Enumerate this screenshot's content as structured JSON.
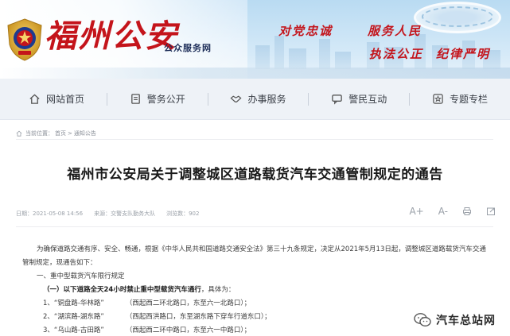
{
  "header": {
    "site_name": "福州公安",
    "site_subtitle": "公众服务网",
    "slogans": [
      "对党忠诚",
      "服务人民",
      "执法公正",
      "纪律严明"
    ]
  },
  "nav": {
    "items": [
      {
        "label": "网站首页",
        "icon": "home-icon"
      },
      {
        "label": "警务公开",
        "icon": "document-icon"
      },
      {
        "label": "办事服务",
        "icon": "handshake-icon"
      },
      {
        "label": "警民互动",
        "icon": "chat-icon"
      },
      {
        "label": "专题专栏",
        "icon": "star-icon"
      }
    ]
  },
  "breadcrumb": {
    "prefix": "当前位置：",
    "items": [
      "首页",
      "通知公告"
    ],
    "separator": ">"
  },
  "article": {
    "title": "福州市公安局关于调整城区道路载货汽车交通管制规定的通告",
    "meta": {
      "date": "日期：2021-05-08 14:56",
      "source": "来源：交警支队勤务大队",
      "views": "浏览数：902"
    },
    "tools": [
      "A+",
      "A-"
    ],
    "intro_line1": "为确保道路交通有序、安全、畅通，根据《中华人民共和国道路交通安全法》第三十九条规定，决定从2021年5月13日起，调整城区道路载货汽车交通",
    "intro_line2": "管制规定，现通告如下：",
    "section1": "一、重中型载货汽车限行规定",
    "sub1_prefix": "（一）",
    "sub1_main": "以下道路全天24小时禁止重中型载货汽车通行",
    "sub1_suffix": "，具体为：",
    "items": [
      {
        "num": "1、",
        "road": "“铜盘路-华林路”",
        "desc": "（西起西二环北路口，东至六一北路口）；"
      },
      {
        "num": "2、",
        "road": "“湖滨路-湖东路”",
        "desc": "（西起西洪路口，东至湖东路下穿车行道东口）；"
      },
      {
        "num": "3、",
        "road": "“乌山路-古田路”",
        "desc": "（西起西二环中路口，东至六一中路口）；"
      }
    ]
  },
  "watermark": {
    "text": "汽车总站网",
    "icon": "wechat-logo-icon"
  },
  "colors": {
    "brand_red": "#c4141b",
    "nav_bg": "#eef2f7",
    "banner_sky": "#cfe6f7"
  }
}
